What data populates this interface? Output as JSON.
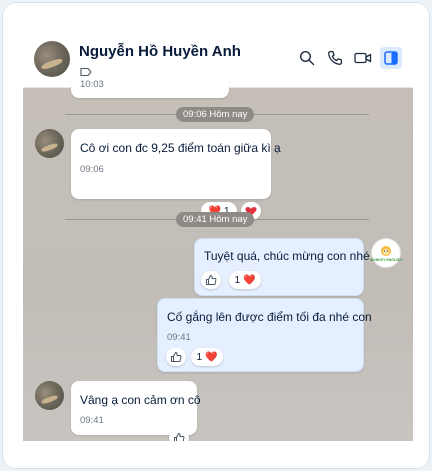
{
  "header": {
    "contact_name": "Nguyễn Hồ Huyền Anh",
    "icons": [
      "search-icon",
      "phone-icon",
      "video-icon",
      "sidebar-toggle-icon"
    ]
  },
  "top_partial": {
    "time": "10:03"
  },
  "date_dividers": [
    {
      "label": "09:06 Hôm nay"
    },
    {
      "label": "09:41 Hôm nay"
    }
  ],
  "messages": [
    {
      "side": "left",
      "text": "Cô ơi con đc 9,25 điểm toán giữa kì ạ",
      "time": "09:06",
      "reaction": {
        "emoji": "❤️",
        "count": "1"
      }
    },
    {
      "side": "right",
      "text": "Tuyệt quá, chúc mừng con nhé",
      "reaction": {
        "emoji": "❤️",
        "count": "1"
      }
    },
    {
      "side": "right",
      "text": "Cố gắng lên được điểm tối đa nhé con",
      "time": "09:41",
      "reaction": {
        "emoji": "❤️",
        "count": "1"
      }
    },
    {
      "side": "left",
      "text": "Vâng ạ con cảm ơn cô",
      "time": "09:41"
    }
  ],
  "self_avatar": {
    "label": "MONKEY ENGLISH"
  },
  "colors": {
    "accent": "#1a6cff",
    "bubble_right": "#e5efff",
    "heart": "#e0303e",
    "chat_background": "#c5bfb8"
  }
}
